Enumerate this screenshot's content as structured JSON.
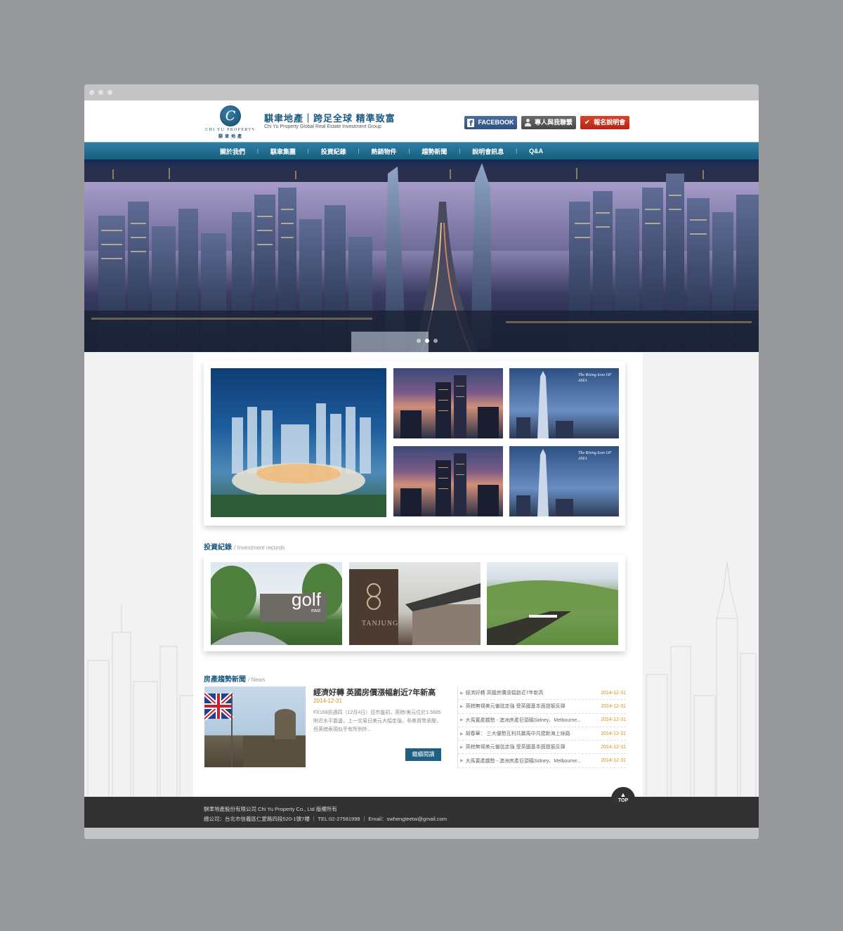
{
  "header": {
    "logo_mark": "C",
    "logo_en": "CHI YU PROPERTY",
    "logo_zh": "騏聿地產",
    "slogan": "騏聿地產｜跨足全球 精準致富",
    "slogan_en": "Chi Yu Property Global Real Estate Investment Group",
    "facebook_label": "FACEBOOK",
    "facebook_icon": "f",
    "contact_label": "專人與我聯繫",
    "signup_label": "報名說明會",
    "signup_icon": "✔"
  },
  "nav": {
    "items": [
      "關於我們",
      "騏聿集團",
      "投資紀錄",
      "熱銷物件",
      "趨勢新聞",
      "說明會訊息",
      "Q&A"
    ],
    "separator": "|"
  },
  "banner": {
    "slide_count": 3,
    "active_slide": 2
  },
  "gallery": {
    "tile_captions": [
      "The Rising Icon OF ASIA",
      "The Rising Icon OF ASIA"
    ]
  },
  "invest": {
    "title": "投資紀錄",
    "subtitle": "/ Investment records",
    "photo_texts": [
      "golf",
      "east",
      "TANJUNG"
    ]
  },
  "news": {
    "title": "房產趨勢新聞",
    "subtitle": "/ News",
    "featured": {
      "headline": "經濟好轉 英國房價漲幅創近7年新高",
      "date": "2014-12-31",
      "text": "FX168訊週四（12月4日）亞市盤初，英鎊/美元位於1.5685附近水平震盪，上一交易日美元大幅走強，非美貨幣承壓，但英鎊表現似乎有所例外...",
      "more_label": "繼續閱讀"
    },
    "list": [
      {
        "title": "經濟好轉 英國房價漲幅創近7年新高",
        "date": "2014-12-31"
      },
      {
        "title": "英鎊無視美元偏弦走強 受英國基本面提振反彈",
        "date": "2014-12-31"
      },
      {
        "title": "大馬置產趨勢 - 澳洲房產巨頭稱Sidney、Melbourne...",
        "date": "2014-12-31"
      },
      {
        "title": "胡春華： 三大優勢互利共贏馬中共建新海上絲路",
        "date": "2014-12-31"
      },
      {
        "title": "英鎊無視美元偏弦走強 受英國基本面提振反彈",
        "date": "2014-12-31"
      },
      {
        "title": "大馬置產趨勢 - 澳洲房產巨頭稱Sidney、Melbourne...",
        "date": "2014-12-31"
      }
    ]
  },
  "footer": {
    "line1": "騏聿地產股份有限公司 Chi Yu Property Co., Ltd 版權所有",
    "line2": "總公司：台北市信義區仁愛路四段520-1號7樓 ｜ TEL:02-27581998 ｜ Email：swhengteetw@gmail.com",
    "top_label": "TOP",
    "top_icon": "▲"
  },
  "colors": {
    "brand_blue": "#1b5a80",
    "nav_blue": "#2f7ea4",
    "facebook": "#3b5b8c",
    "signup_red": "#c8341e",
    "date_orange": "#e08a1e",
    "footer_bg": "#323232"
  }
}
